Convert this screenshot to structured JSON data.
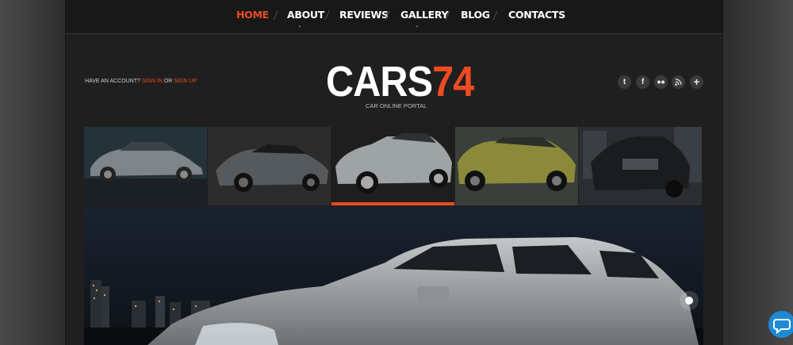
{
  "nav": {
    "items": [
      {
        "label": "HOME",
        "active": true
      },
      {
        "label": "ABOUT",
        "has_dropdown": true
      },
      {
        "label": "REVIEWS"
      },
      {
        "label": "GALLERY",
        "has_dropdown": true
      },
      {
        "label": "BLOG"
      },
      {
        "label": "CONTACTS"
      }
    ]
  },
  "header": {
    "account_prompt": "HAVE AN ACCOUNT?",
    "sign_in": "SIGN IN",
    "or": "OR",
    "sign_up": "SIGN UP",
    "logo_white": "CARS",
    "logo_orange": "74",
    "tagline": "CAR ONLINE PORTAL"
  },
  "social": [
    "twitter-icon",
    "facebook-icon",
    "flickr-icon",
    "rss-icon",
    "plus-icon"
  ],
  "colors": {
    "accent": "#ee4b22",
    "background": "#1f1f1f",
    "chat": "#1e8ad6"
  }
}
